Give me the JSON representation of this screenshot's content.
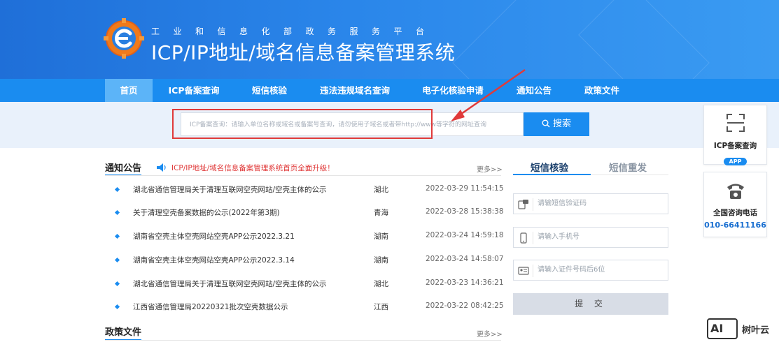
{
  "header": {
    "subtitle": "工业和信息化部政务服务平台",
    "title": "ICP/IP地址/域名信息备案管理系统"
  },
  "nav": {
    "items": [
      "首页",
      "ICP备案查询",
      "短信核验",
      "违法违规域名查询",
      "电子化核验申请",
      "通知公告",
      "政策文件"
    ],
    "active": "首页"
  },
  "search": {
    "placeholder": "ICP备案查询：请输入单位名称或域名或备案号查询，请勿使用子域名或者带http://www等字符的网址查询",
    "button_label": "搜索"
  },
  "notice": {
    "title": "通知公告",
    "headline": "ICP/IP地址/域名信息备案管理系统首页全面升级！",
    "more": "更多>>",
    "items": [
      {
        "title": "湖北省通信管理局关于清理互联网空壳网站/空壳主体的公示",
        "province": "湖北",
        "date": "2022-03-29 11:54:15"
      },
      {
        "title": "关于清理空壳备案数据的公示(2022年第3期)",
        "province": "青海",
        "date": "2022-03-28 15:38:38"
      },
      {
        "title": "湖南省空壳主体空壳网站空壳APP公示2022.3.21",
        "province": "湖南",
        "date": "2022-03-24 14:59:18"
      },
      {
        "title": "湖南省空壳主体空壳网站空壳APP公示2022.3.14",
        "province": "湖南",
        "date": "2022-03-24 14:58:07"
      },
      {
        "title": "湖北省通信管理局关于清理互联网空壳网站/空壳主体的公示",
        "province": "湖北",
        "date": "2022-03-23 14:36:21"
      },
      {
        "title": "江西省通信管理局20220321批次空壳数据公示",
        "province": "江西",
        "date": "2022-03-22 08:42:25"
      }
    ]
  },
  "policy": {
    "title": "政策文件",
    "more": "更多>>"
  },
  "sms": {
    "tab_active": "短信核验",
    "tab_inactive": "短信重发",
    "code_placeholder": "请输短信验证码",
    "phone_placeholder": "请输入手机号",
    "id_placeholder": "请输入证件号码后6位",
    "submit_label": "提 交"
  },
  "side": {
    "app_label": "ICP备案查询",
    "app_badge": "APP",
    "hotline_label": "全国咨询电话",
    "hotline_number": "010-66411166"
  },
  "watermark": {
    "badge": "AI",
    "text": "树叶云"
  },
  "colors": {
    "primary": "#1a8cf0",
    "header_dark": "#1f6fd8",
    "alert_red": "#e03a3a",
    "search_band": "#e9f1fb"
  }
}
